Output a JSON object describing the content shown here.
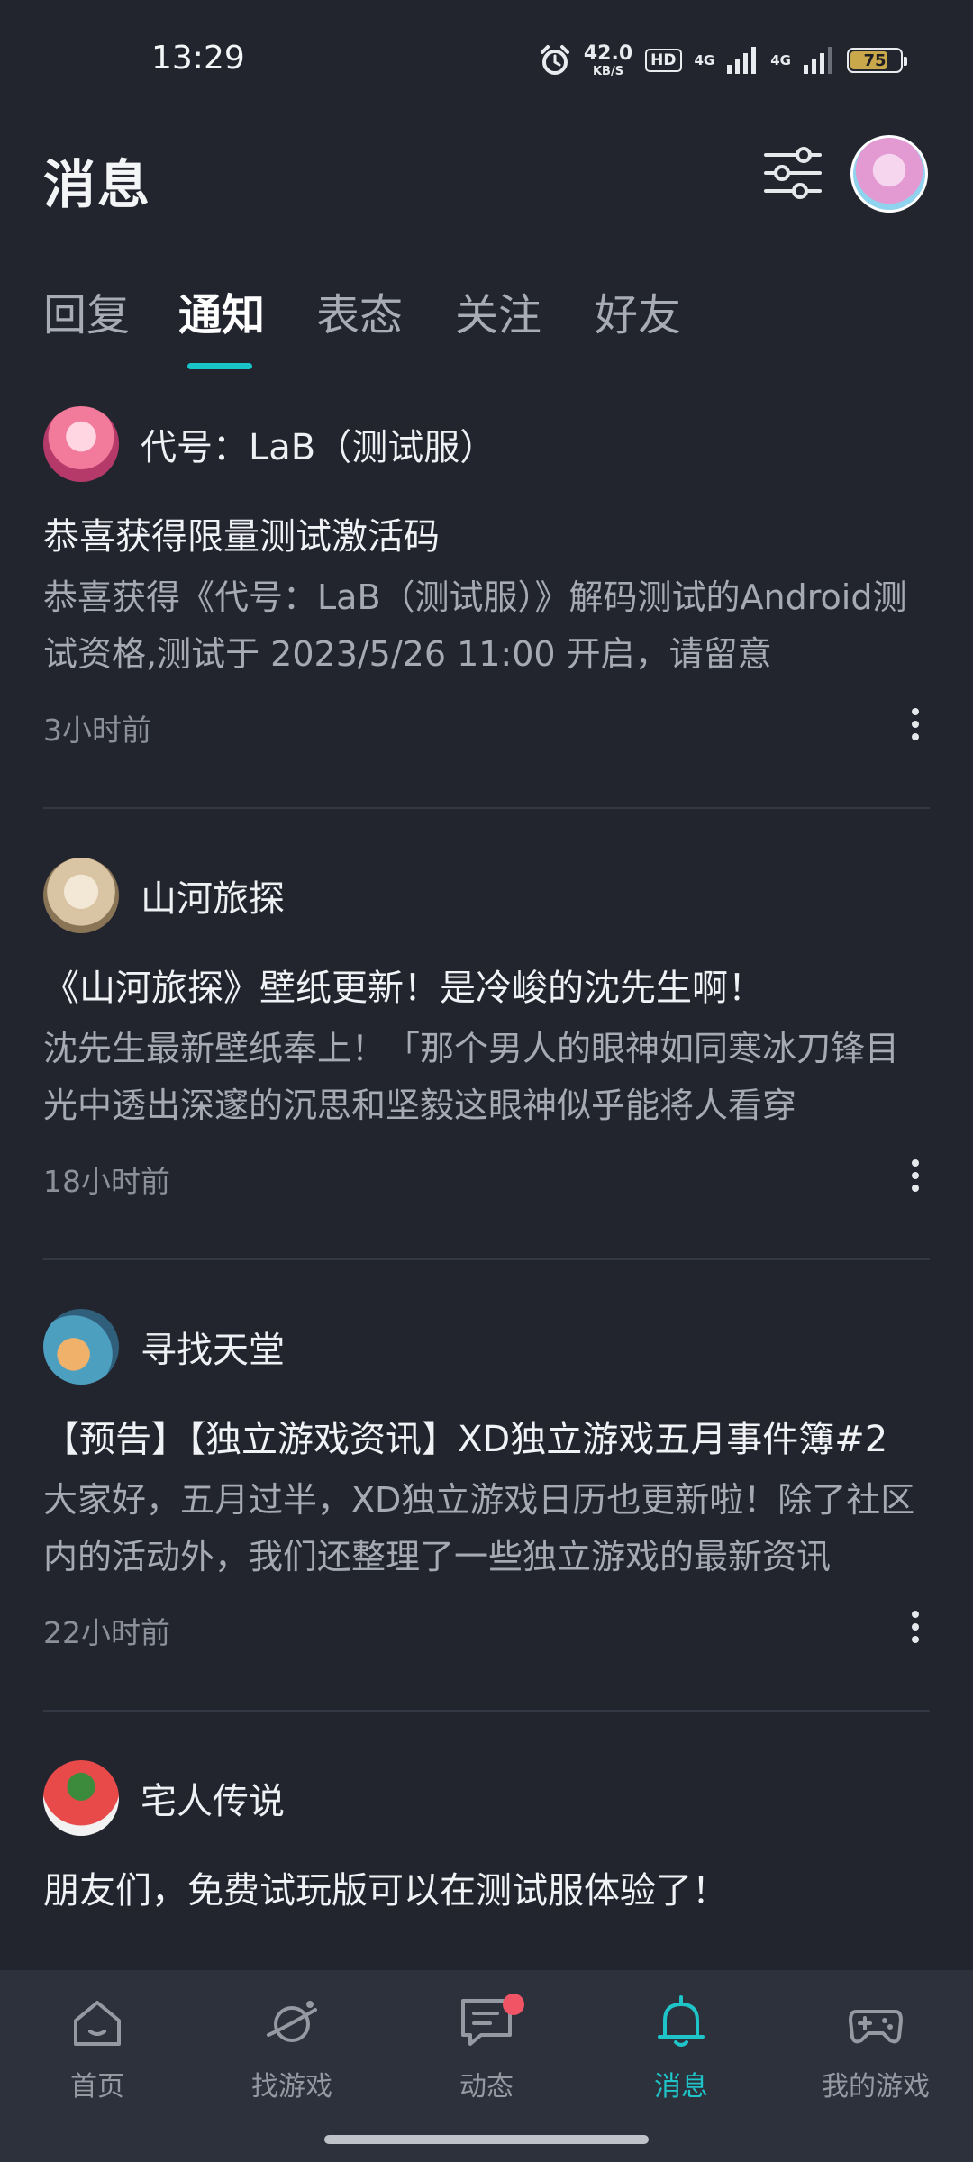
{
  "status_bar": {
    "time": "13:29",
    "net_speed": "42.0",
    "net_unit": "KB/S",
    "hd_label": "HD",
    "signal_1": "4G",
    "signal_2": "4G",
    "battery": "75",
    "battery_level": 0.75,
    "icons": [
      "alarm-icon",
      "signal-icon",
      "battery-icon"
    ]
  },
  "header": {
    "title": "消息",
    "icons": [
      "filter-icon",
      "avatar"
    ]
  },
  "tabs": [
    {
      "label": "回复",
      "active": false
    },
    {
      "label": "通知",
      "active": true
    },
    {
      "label": "表态",
      "active": false
    },
    {
      "label": "关注",
      "active": false
    },
    {
      "label": "好友",
      "active": false
    }
  ],
  "notifications": [
    {
      "author": "代号：LaB（测试服）",
      "title": "恭喜获得限量测试激活码",
      "body": "恭喜获得《代号：LaB（测试服）》解码测试的Android测试资格,测试于 2023/5/26 11:00 开启，请留意",
      "time": "3小时前"
    },
    {
      "author": "山河旅探",
      "title": "《山河旅探》壁纸更新！是冷峻的沈先生啊！",
      "body": "沈先生最新壁纸奉上！「那个男人的眼神如同寒冰刀锋目光中透出深邃的沉思和坚毅这眼神似乎能将人看穿",
      "time": "18小时前"
    },
    {
      "author": "寻找天堂",
      "title": "【预告】【独立游戏资讯】XD独立游戏五月事件簿#2",
      "body": "大家好，五月过半，XD独立游戏日历也更新啦！除了社区内的活动外，我们还整理了一些独立游戏的最新资讯",
      "time": "22小时前"
    },
    {
      "author": "宅人传说",
      "title": "朋友们，免费试玩版可以在测试服体验了！",
      "body": "",
      "time": ""
    }
  ],
  "bottom_nav": [
    {
      "label": "首页",
      "icon": "home-icon",
      "active": false
    },
    {
      "label": "找游戏",
      "icon": "planet-icon",
      "active": false
    },
    {
      "label": "动态",
      "icon": "chat-icon",
      "active": false,
      "badge": true
    },
    {
      "label": "消息",
      "icon": "bell-icon",
      "active": true
    },
    {
      "label": "我的游戏",
      "icon": "gamepad-icon",
      "active": false
    }
  ],
  "colors": {
    "background": "#22252e",
    "accent": "#18c4c8",
    "nav_background": "#2d313c",
    "badge": "#f15565"
  }
}
